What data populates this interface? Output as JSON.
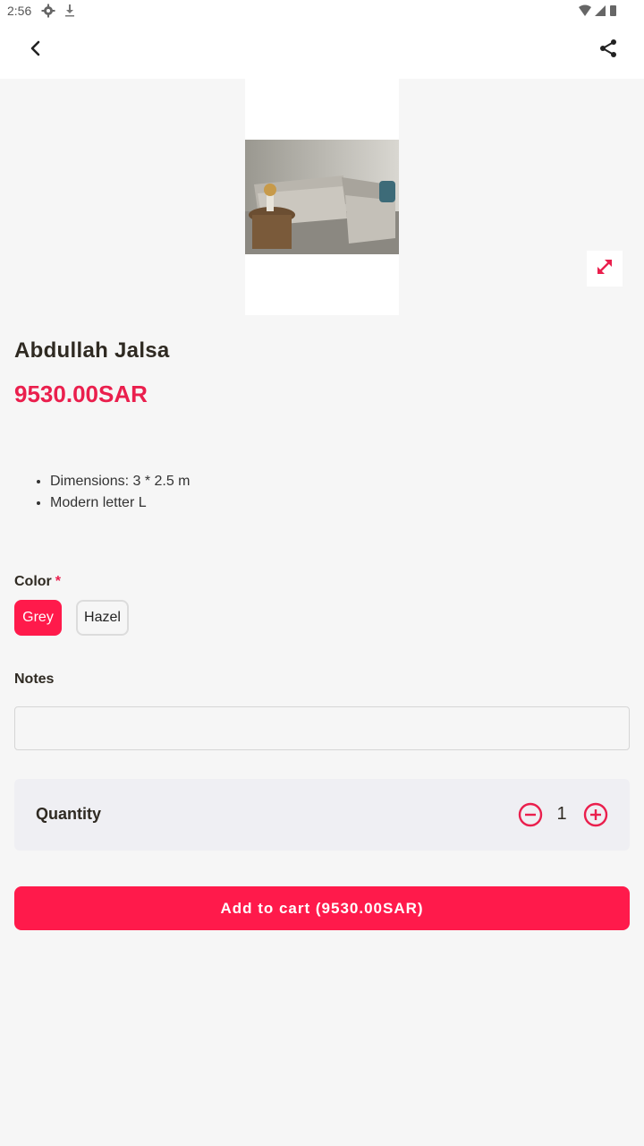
{
  "status_bar": {
    "time": "2:56",
    "icons": [
      "settings-gear-icon",
      "download-icon",
      "wifi-icon",
      "cell-signal-icon",
      "battery-icon"
    ]
  },
  "app_bar": {
    "back_icon": "chevron-left-icon",
    "share_icon": "share-icon"
  },
  "product": {
    "image_alt": "L-shaped grey sofa",
    "expand_icon": "expand-arrows-icon",
    "title": "Abdullah Jalsa",
    "price": "9530.00SAR",
    "description": [
      "Dimensions: 3 * 2.5 m",
      "Modern letter L"
    ]
  },
  "color_option": {
    "label": "Color",
    "required_mark": "*",
    "options": [
      {
        "label": "Grey",
        "selected": true
      },
      {
        "label": "Hazel",
        "selected": false
      }
    ]
  },
  "notes": {
    "label": "Notes",
    "value": "",
    "placeholder": ""
  },
  "quantity": {
    "label": "Quantity",
    "value": "1",
    "minus_icon": "minus-circle-icon",
    "plus_icon": "plus-circle-icon"
  },
  "cart_button": {
    "label": "Add to cart (9530.00SAR)"
  },
  "colors": {
    "accent": "#ff1a4b",
    "price": "#ea1f4d",
    "background": "#f6f6f6",
    "card": "#efeff3"
  }
}
